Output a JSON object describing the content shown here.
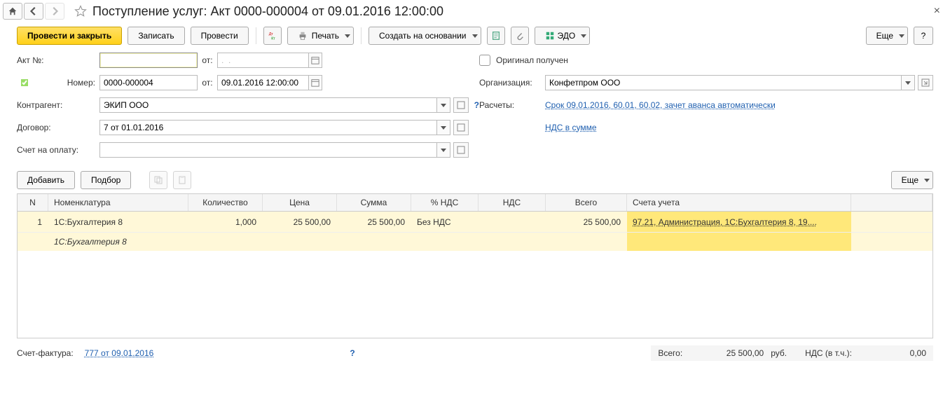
{
  "header": {
    "title": "Поступление услуг: Акт 0000-000004 от 09.01.2016 12:00:00"
  },
  "toolbar": {
    "post_close": "Провести и закрыть",
    "save": "Записать",
    "post": "Провести",
    "print": "Печать",
    "create_based": "Создать на основании",
    "edo": "ЭДО",
    "more": "Еще",
    "help": "?"
  },
  "form": {
    "act_label": "Акт №:",
    "act_no": "",
    "from1": "от:",
    "act_date": ".  .",
    "number_label": "Номер:",
    "number": "0000-000004",
    "from2": "от:",
    "doc_date": "09.01.2016 12:00:00",
    "counterparty_label": "Контрагент:",
    "counterparty": "ЭКИП ООО",
    "contract_label": "Договор:",
    "contract": "7 от 01.01.2016",
    "invoice_label": "Счет на оплату:",
    "invoice": "",
    "original_received": "Оригинал получен",
    "org_label": "Организация:",
    "org": "Конфетпром ООО",
    "calc_label": "Расчеты:",
    "calc_link": "Срок 09.01.2016, 60.01, 60.02, зачет аванса автоматически",
    "nds_link": "НДС в сумме"
  },
  "tabbar": {
    "add": "Добавить",
    "pick": "Подбор",
    "more": "Еще"
  },
  "grid": {
    "headers": {
      "n": "N",
      "nom": "Номенклатура",
      "qty": "Количество",
      "price": "Цена",
      "sum": "Сумма",
      "vat": "% НДС",
      "nds": "НДС",
      "total": "Всего",
      "acc": "Счета учета"
    },
    "rows": [
      {
        "n": "1",
        "nom1": "1С:Бухгалтерия 8",
        "nom2": "1С:Бухгалтерия 8",
        "qty": "1,000",
        "price": "25 500,00",
        "sum": "25 500,00",
        "vat": "Без НДС",
        "nds": "",
        "total": "25 500,00",
        "acc": "97.21, Администрация, 1С:Бухгалтерия 8, 19...."
      }
    ]
  },
  "footer": {
    "sf_label": "Счет-фактура:",
    "sf_link": "777 от 09.01.2016",
    "total_label": "Всего:",
    "total_val": "25 500,00",
    "currency": "руб.",
    "nds_label": "НДС (в т.ч.):",
    "nds_val": "0,00"
  }
}
